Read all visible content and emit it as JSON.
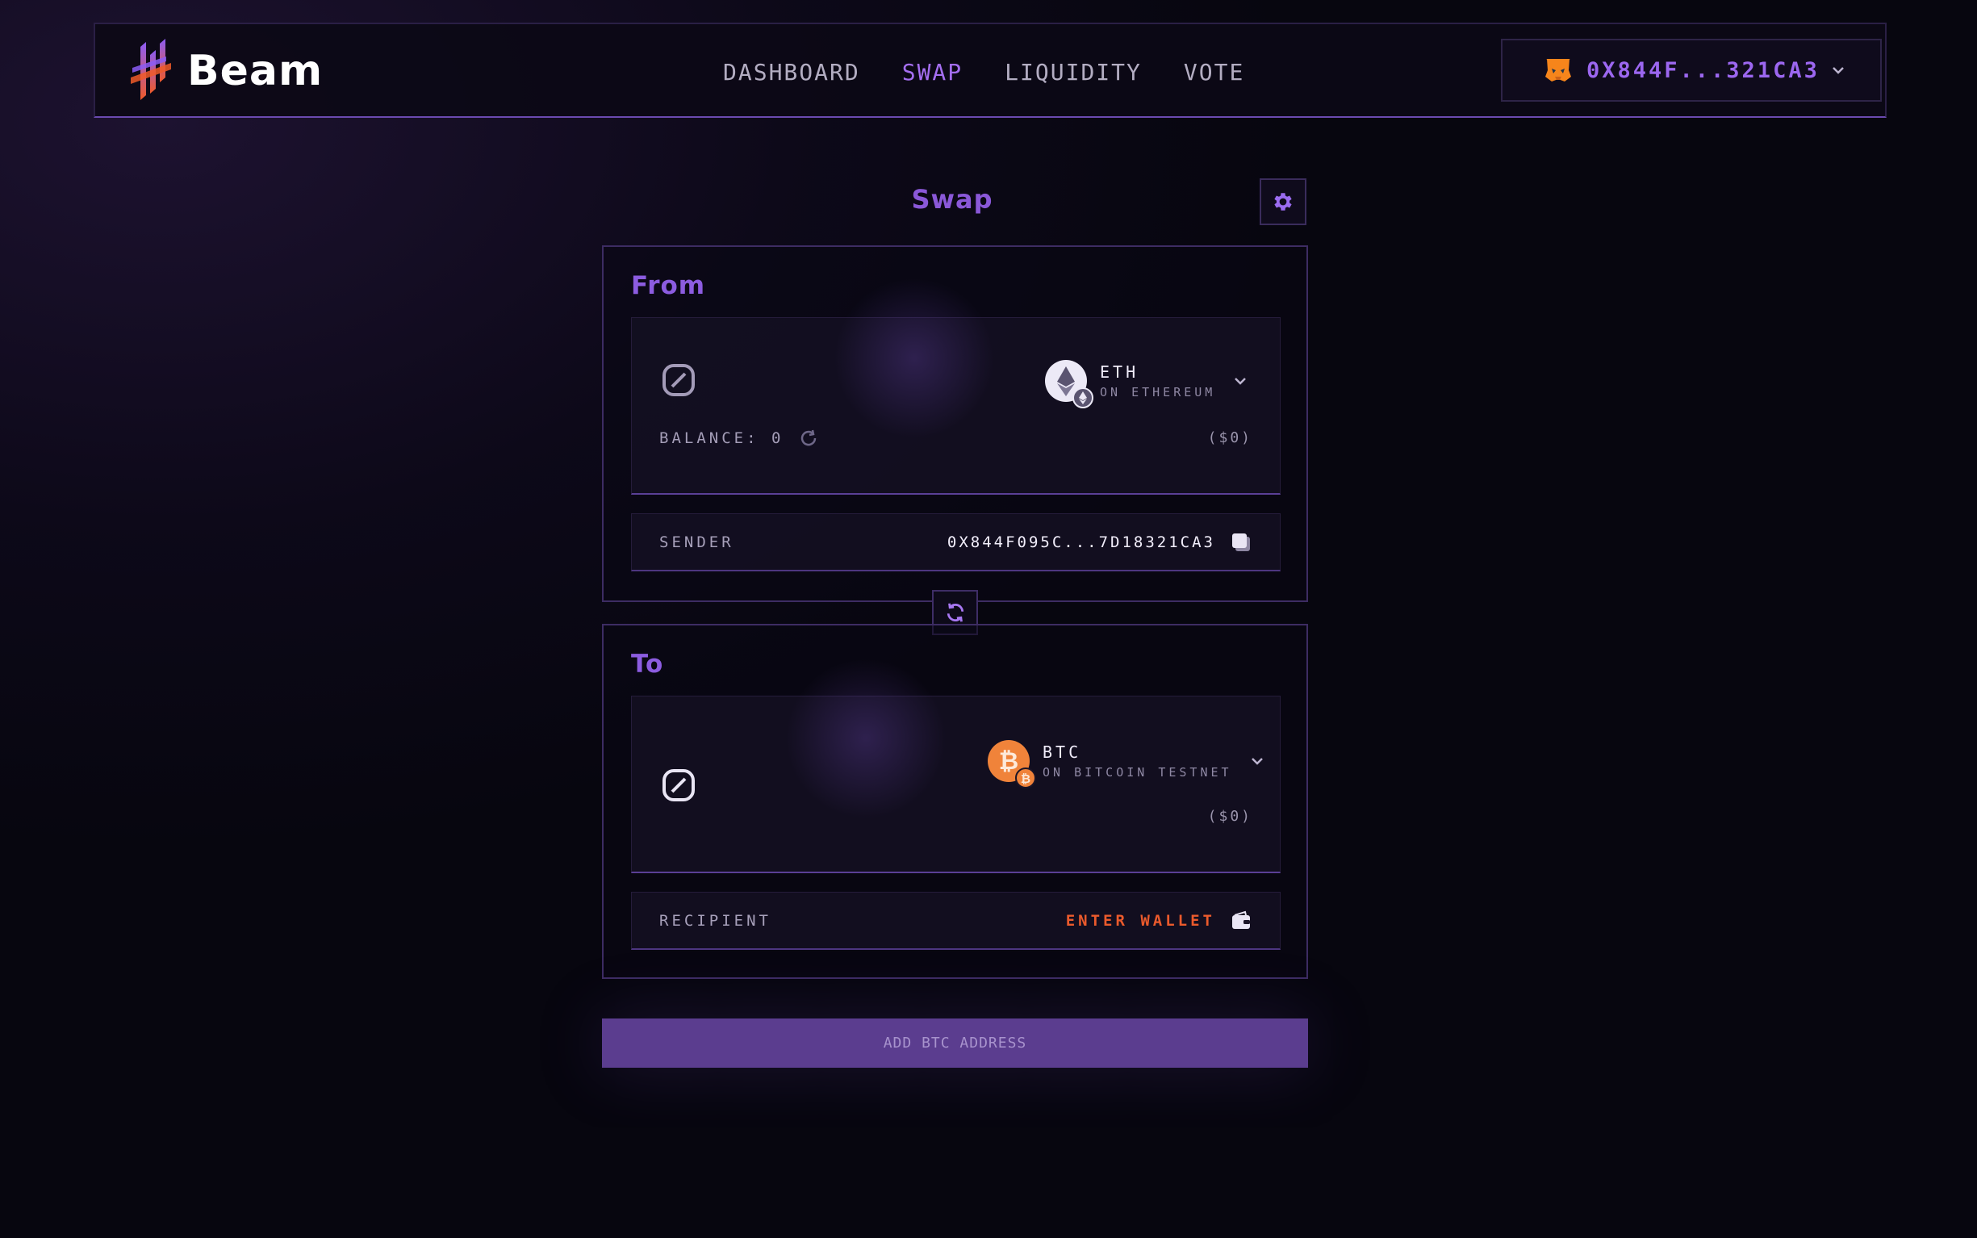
{
  "header": {
    "brand": "Beam",
    "nav": [
      {
        "label": "DASHBOARD",
        "active": false
      },
      {
        "label": "SWAP",
        "active": true
      },
      {
        "label": "LIQUIDITY",
        "active": false
      },
      {
        "label": "VOTE",
        "active": false
      }
    ],
    "wallet": {
      "address": "0X844F...321CA3",
      "icon": "metamask-fox-icon"
    }
  },
  "swap": {
    "title": "Swap",
    "from": {
      "label": "From",
      "token": {
        "symbol": "ETH",
        "network": "ON ETHEREUM",
        "icon": "ethereum-icon"
      },
      "usd_value": "($0)",
      "balance": "BALANCE: 0",
      "sender_label": "SENDER",
      "sender_address": "0X844F095C...7D18321CA3"
    },
    "to": {
      "label": "To",
      "token": {
        "symbol": "BTC",
        "network": "ON BITCOIN TESTNET",
        "icon": "bitcoin-icon"
      },
      "usd_value": "($0)",
      "recipient_label": "RECIPIENT",
      "recipient_action": "ENTER WALLET"
    },
    "cta_label": "ADD BTC ADDRESS"
  },
  "colors": {
    "accent": "#9c67f0",
    "warning": "#ea5a2c",
    "button": "#5b3d8f",
    "background": "#0d0919"
  }
}
